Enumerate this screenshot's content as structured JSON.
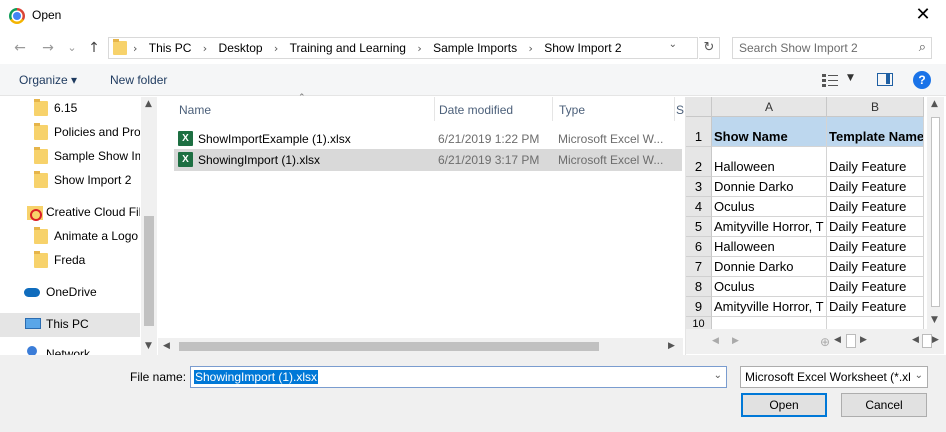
{
  "window": {
    "title": "Open",
    "close_glyph": "✕"
  },
  "nav": {
    "back": "←",
    "forward": "→",
    "recent": "⌄",
    "up": "↑"
  },
  "address": {
    "crumbs": [
      "This PC",
      "Desktop",
      "Training and Learning",
      "Sample Imports",
      "Show Import 2"
    ],
    "separator": "›",
    "dropdown": "⌄",
    "refresh": "↻"
  },
  "search": {
    "placeholder": "Search Show Import 2",
    "icon": "⌕"
  },
  "toolbar": {
    "organize": "Organize ▾",
    "new_folder": "New folder",
    "help": "?",
    "view_dropdown": "▼"
  },
  "navpane": {
    "items": [
      {
        "label": "6.15",
        "icon": "folder-icon"
      },
      {
        "label": "Policies and Proc",
        "icon": "folder-icon"
      },
      {
        "label": "Sample Show Im",
        "icon": "folder-icon"
      },
      {
        "label": "Show Import 2",
        "icon": "folder-icon"
      },
      {
        "label": "Creative Cloud Fil",
        "icon": "creative-cloud-icon"
      },
      {
        "label": "Animate a Logo",
        "icon": "folder-icon"
      },
      {
        "label": "Freda",
        "icon": "folder-icon"
      },
      {
        "label": "OneDrive",
        "icon": "onedrive-icon"
      },
      {
        "label": "This PC",
        "icon": "computer-icon"
      },
      {
        "label": "Network",
        "icon": "network-icon"
      }
    ]
  },
  "filelist": {
    "columns": [
      "Name",
      "Date modified",
      "Type",
      "S"
    ],
    "sort_glyph": "⌃",
    "rows": [
      {
        "name": "ShowImportExample (1).xlsx",
        "date": "6/21/2019 1:22 PM",
        "type": "Microsoft Excel W...",
        "selected": false
      },
      {
        "name": "ShowingImport (1).xlsx",
        "date": "6/21/2019 3:17 PM",
        "type": "Microsoft Excel W...",
        "selected": true
      }
    ]
  },
  "preview": {
    "columns": [
      "A",
      "B"
    ],
    "rows": [
      {
        "n": "1",
        "a": "Show Name",
        "b": "Template Name",
        "header": true
      },
      {
        "n": "2",
        "a": "Halloween",
        "b": "Daily Feature"
      },
      {
        "n": "3",
        "a": "Donnie Darko",
        "b": "Daily Feature"
      },
      {
        "n": "4",
        "a": "Oculus",
        "b": "Daily Feature"
      },
      {
        "n": "5",
        "a": "Amityville Horror, T",
        "b": "Daily Feature"
      },
      {
        "n": "6",
        "a": "Halloween",
        "b": "Daily Feature"
      },
      {
        "n": "7",
        "a": "Donnie Darko",
        "b": "Daily Feature"
      },
      {
        "n": "8",
        "a": "Oculus",
        "b": "Daily Feature"
      },
      {
        "n": "9",
        "a": "Amityville Horror, T",
        "b": "Daily Feature"
      },
      {
        "n": "10",
        "a": "",
        "b": ""
      }
    ]
  },
  "bottom": {
    "filename_label": "File name:",
    "filename_value": "ShowingImport (1).xlsx",
    "filetype_value": "Microsoft Excel Worksheet (*.xlsx)",
    "open": "Open",
    "cancel": "Cancel"
  },
  "colors": {
    "accent": "#0078d7",
    "selection": "#d9d9d9",
    "header_fill": "#bdd7ee"
  }
}
